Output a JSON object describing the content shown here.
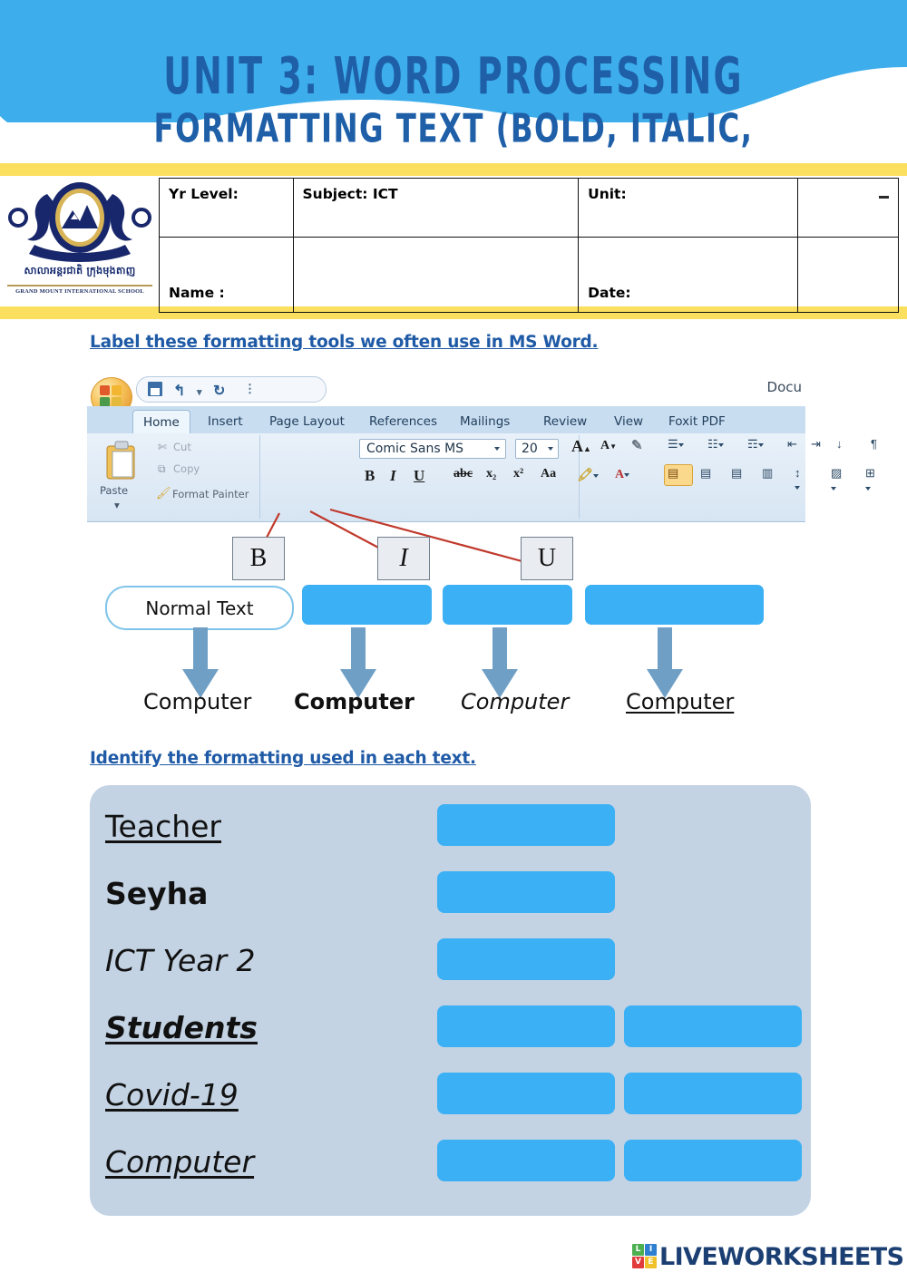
{
  "header": {
    "title_line1": "UNIT 3: WORD PROCESSING",
    "title_line2": "FORMATTING TEXT (BOLD, ITALIC, UNDERLINE)",
    "wave_color": "#3dadeb",
    "title_color": "#1e5fa8",
    "accent_bar_color": "#fbdf5e"
  },
  "logo": {
    "khmer_text": "សាលាអន្តរជាតិ ក្រុងមុងតាញ",
    "english_text": "GRAND MOUNT INTERNATIONAL SCHOOL",
    "alt": "grand-mount-international-school-crest"
  },
  "info_table": {
    "yr_level_label": "Yr Level:",
    "subject_label": "Subject:  ICT",
    "unit_label": "Unit:",
    "mark_label": "-",
    "name_label": "Name :",
    "date_label": "Date:"
  },
  "instructions": {
    "one": "Label these formatting tools we often use in MS Word.",
    "two": "Identify the formatting used in each text."
  },
  "ribbon": {
    "document_title": "Docu",
    "quick_access": [
      "save-icon",
      "undo-icon",
      "redo-icon",
      "customize-icon"
    ],
    "tabs": [
      "Home",
      "Insert",
      "Page Layout",
      "References",
      "Mailings",
      "Review",
      "View",
      "Foxit PDF"
    ],
    "selected_tab": "Home",
    "clipboard": {
      "paste_label": "Paste",
      "cut_label": "Cut",
      "copy_label": "Copy",
      "format_painter_label": "Format Painter"
    },
    "font_group": {
      "font_name": "Comic Sans MS",
      "font_size": "20",
      "buttons": [
        "B",
        "I",
        "U",
        "abc",
        "x₂",
        "x²",
        "Aa"
      ]
    }
  },
  "label_exercise": {
    "callouts": [
      "B",
      "I",
      "U"
    ],
    "columns": [
      {
        "label": "Normal Text",
        "is_answer_field": false,
        "sample": "Computer",
        "style": "normal"
      },
      {
        "label": "",
        "is_answer_field": true,
        "sample": "Computer",
        "style": "bold"
      },
      {
        "label": "",
        "is_answer_field": true,
        "sample": "Computer",
        "style": "italic"
      },
      {
        "label": "",
        "is_answer_field": true,
        "sample": "Computer",
        "style": "underline"
      }
    ]
  },
  "identify_exercise": {
    "panel_color": "#c3d3e4",
    "field_color": "#3bb0f5",
    "rows": [
      {
        "text": "Teacher",
        "style": "underline",
        "fields": 1
      },
      {
        "text": "Seyha",
        "style": "bold",
        "fields": 1
      },
      {
        "text": "ICT Year 2",
        "style": "italic",
        "fields": 1
      },
      {
        "text": "Students",
        "style": "bold-italic-underline",
        "fields": 2
      },
      {
        "text": "Covid-19",
        "style": "italic-underline",
        "fields": 2
      },
      {
        "text": "Computer",
        "style": "italic-underline",
        "fields": 2
      }
    ]
  },
  "footer": {
    "brand": "LIVEWORKSHEETS",
    "tiles": [
      {
        "letter": "L",
        "color": "#4caf50"
      },
      {
        "letter": "I",
        "color": "#2f7fd0"
      },
      {
        "letter": "V",
        "color": "#e23b3b"
      },
      {
        "letter": "E",
        "color": "#efc22b"
      }
    ]
  }
}
